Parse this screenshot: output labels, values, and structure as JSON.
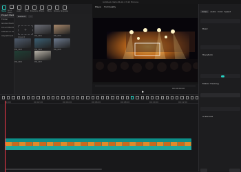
{
  "app": {
    "title": "Untitled 2024-05-04 17:45 Filmora"
  },
  "toolbar": {
    "items": [
      {
        "label": "Media",
        "active": true,
        "icon": "media-icon"
      },
      {
        "label": "Stock Media",
        "icon": "stock-icon"
      },
      {
        "label": "Audio",
        "icon": "audio-icon"
      },
      {
        "label": "Titles",
        "icon": "titles-icon"
      },
      {
        "label": "Transitions",
        "icon": "transitions-icon"
      },
      {
        "label": "Effects",
        "icon": "effects-icon"
      },
      {
        "label": "Filters",
        "icon": "filters-icon"
      },
      {
        "label": "Stickers",
        "icon": "stickers-icon"
      },
      {
        "label": "Templates",
        "icon": "templates-icon"
      }
    ]
  },
  "left_nav": {
    "items": [
      "Project Media",
      "Folder",
      "Global Media",
      "Cloud Media",
      "Influence Kit",
      "Adjustment"
    ]
  },
  "media": {
    "import_label": "Import",
    "filter_label": "Default",
    "thumbnails": [
      {
        "name": "IMG_0001"
      },
      {
        "name": "IMG_0002"
      },
      {
        "name": "IMG_0003"
      },
      {
        "name": "IMG_0004"
      },
      {
        "name": "IMG_0005"
      },
      {
        "name": "IMG_0006"
      },
      {
        "name": "IMG_0007"
      }
    ]
  },
  "player": {
    "tabs": [
      "Player",
      "Full Quality"
    ],
    "timecode": "00:00:00:00",
    "duration": "00:00:12:05"
  },
  "props": {
    "tabs": [
      "Video",
      "Audio",
      "Color",
      "Speed"
    ],
    "sections": [
      "Basic",
      "Transform",
      "Compositing",
      "Stabilization",
      "Auto Enhance",
      "Drop Shadow",
      "Motion Tracking",
      "Mask",
      "AI Portrait"
    ]
  },
  "timeline": {
    "ruler": [
      "00:00",
      "00:02:00",
      "00:04:00",
      "00:06:00",
      "00:08:00",
      "00:10:00",
      "00:12:00"
    ]
  },
  "colors": {
    "accent": "#27d3c4",
    "playhead": "#ff3b4c",
    "clip": "#0d8f89"
  }
}
